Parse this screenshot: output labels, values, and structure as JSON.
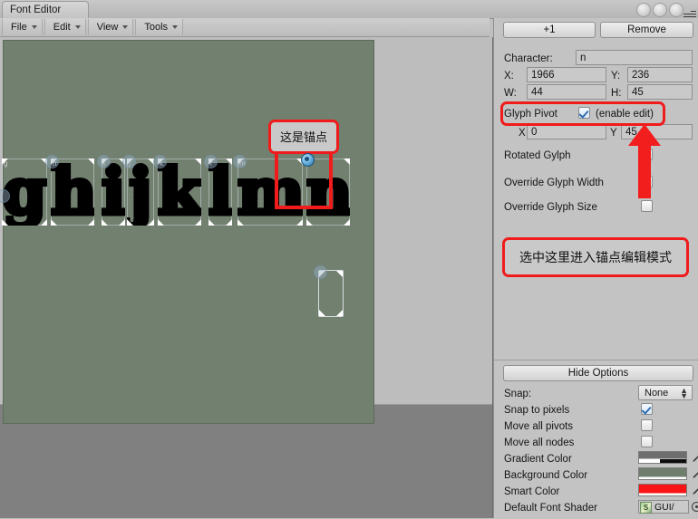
{
  "window": {
    "tab_title": "Font Editor",
    "controls": [
      "minimize",
      "maximize",
      "close"
    ],
    "menu_icon": "hamburger-menu-icon"
  },
  "menubar": {
    "items": [
      {
        "label": "File"
      },
      {
        "label": "Edit"
      },
      {
        "label": "View"
      },
      {
        "label": "Tools"
      }
    ]
  },
  "canvas": {
    "background_color": "#72806f",
    "glyphs": [
      {
        "letter": "g",
        "tag": "g"
      },
      {
        "letter": "h",
        "tag": "h"
      },
      {
        "letter": "i",
        "tag": "i"
      },
      {
        "letter": "j",
        "tag": "j"
      },
      {
        "letter": "k",
        "tag": "k"
      },
      {
        "letter": "l",
        "tag": "l"
      },
      {
        "letter": "m",
        "tag": "m"
      },
      {
        "letter": "n",
        "tag": "n"
      }
    ],
    "annotations": [
      {
        "id": "anchor-note",
        "text": "这是锚点"
      }
    ]
  },
  "inspector": {
    "add_button": "+1",
    "remove_button": "Remove",
    "character_label": "Character:",
    "character_value": "n",
    "x_label": "X:",
    "x_value": "1966",
    "y_label": "Y:",
    "y_value": "236",
    "w_label": "W:",
    "w_value": "44",
    "h_label": "H:",
    "h_value": "45",
    "glyph_pivot_label": "Glyph Pivot",
    "enable_edit_label": "(enable edit)",
    "enable_edit_checked": true,
    "pivot_x_label": "X",
    "pivot_x_value": "0",
    "pivot_y_label": "Y",
    "pivot_y_value": "45",
    "rotated_glyph_label": "Rotated Gylph",
    "rotated_glyph_checked": false,
    "override_width_label": "Override Glyph Width",
    "override_width_checked": false,
    "override_size_label": "Override Glyph Size",
    "override_size_checked": false,
    "annotation_note": "选中这里进入锚点编辑模式"
  },
  "options": {
    "hide_options_button": "Hide Options",
    "snap_label": "Snap:",
    "snap_value": "None",
    "snap_to_pixels_label": "Snap to pixels",
    "snap_to_pixels_checked": true,
    "move_all_pivots_label": "Move all pivots",
    "move_all_pivots_checked": false,
    "move_all_nodes_label": "Move all nodes",
    "move_all_nodes_checked": false,
    "gradient_color_label": "Gradient Color",
    "gradient_color_value": "#6b6b6b",
    "background_color_label": "Background Color",
    "background_color_value": "#6e7d6c",
    "smart_color_label": "Smart Color",
    "smart_color_value": "#f81414",
    "default_font_shader_label": "Default Font Shader",
    "default_font_shader_value": "GUI/"
  },
  "theme": {
    "accent_red": "#f01c1c",
    "panel_bg": "#c3c3c3",
    "workspace_bg": "#808080"
  }
}
